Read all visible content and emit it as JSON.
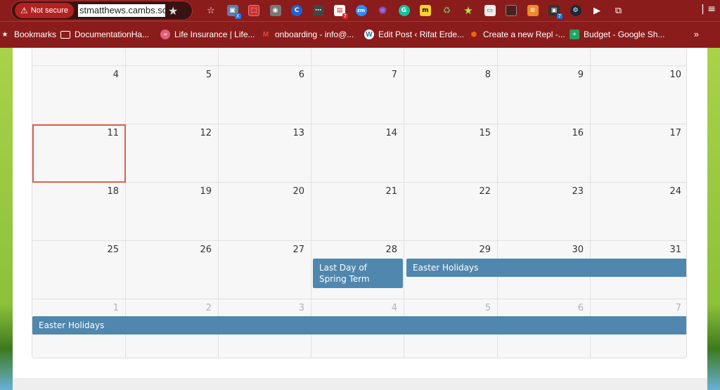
{
  "browser": {
    "security_label": "Not secure",
    "url": "stmatthews.cambs.sc",
    "extension_icons": [
      "star-icon",
      "tab-groups-icon",
      "screencast-icon",
      "camera-icon",
      "c-ext-icon",
      "dots-ext-icon",
      "todo-ext-icon",
      "zoom-ext-icon",
      "gear-ext-icon",
      "grammarly-icon",
      "miro-icon",
      "recycle-icon",
      "bookmark-star-icon",
      "window-icon",
      "app-icon",
      "layers-icon",
      "tabs-icon",
      "steam-icon",
      "cursor-icon",
      "puzzle-icon",
      "profile-icon"
    ],
    "badges": {
      "tab_groups": "X",
      "todo": "7",
      "tabs": "7"
    },
    "bookmarks": [
      {
        "label": "Bookmarks",
        "icon": "star-icon"
      },
      {
        "label": "DocumentationHa...",
        "icon": "folder-icon"
      },
      {
        "label": "Life Insurance | Life...",
        "icon": "lifeins-icon"
      },
      {
        "label": "onboarding - info@...",
        "icon": "gmail-icon"
      },
      {
        "label": "Edit Post ‹ Rifat Erde...",
        "icon": "wordpress-icon"
      },
      {
        "label": "Create a new Repl -...",
        "icon": "replit-icon"
      },
      {
        "label": "Budget - Google Sh...",
        "icon": "sheets-icon"
      }
    ],
    "more_label": "»"
  },
  "calendar": {
    "weeks": [
      {
        "days": [
          {
            "n": "4"
          },
          {
            "n": "5"
          },
          {
            "n": "6"
          },
          {
            "n": "7"
          },
          {
            "n": "8"
          },
          {
            "n": "9"
          },
          {
            "n": "10"
          }
        ]
      },
      {
        "days": [
          {
            "n": "11"
          },
          {
            "n": "12"
          },
          {
            "n": "13"
          },
          {
            "n": "14"
          },
          {
            "n": "15"
          },
          {
            "n": "16"
          },
          {
            "n": "17"
          }
        ]
      },
      {
        "days": [
          {
            "n": "18"
          },
          {
            "n": "19"
          },
          {
            "n": "20"
          },
          {
            "n": "21"
          },
          {
            "n": "22"
          },
          {
            "n": "23"
          },
          {
            "n": "24"
          }
        ]
      },
      {
        "days": [
          {
            "n": "25"
          },
          {
            "n": "26"
          },
          {
            "n": "27"
          },
          {
            "n": "28"
          },
          {
            "n": "29"
          },
          {
            "n": "30"
          },
          {
            "n": "31"
          }
        ]
      },
      {
        "days": [
          {
            "n": "1"
          },
          {
            "n": "2"
          },
          {
            "n": "3"
          },
          {
            "n": "4"
          },
          {
            "n": "5"
          },
          {
            "n": "6"
          },
          {
            "n": "7"
          }
        ]
      }
    ],
    "today": "11",
    "events": {
      "last_day": "Last Day of Spring Term",
      "easter_1": "Easter Holidays",
      "easter_2": "Easter Holidays"
    }
  },
  "colors": {
    "event": "#5087ae",
    "today_border": "#e3604a",
    "chrome": "#8b1c1c"
  }
}
